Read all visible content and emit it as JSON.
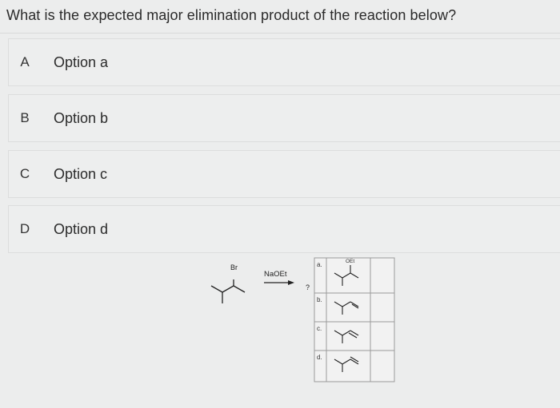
{
  "question": "What is the expected major elimination product of the reaction below?",
  "options": [
    {
      "letter": "A",
      "label": "Option a"
    },
    {
      "letter": "B",
      "label": "Option b"
    },
    {
      "letter": "C",
      "label": "Option c"
    },
    {
      "letter": "D",
      "label": "Option d"
    }
  ],
  "figure": {
    "substituent": "Br",
    "reagent": "NaOEt",
    "unknown": "?",
    "choices": [
      {
        "letter": "a.",
        "group": "OEt"
      },
      {
        "letter": "b."
      },
      {
        "letter": "c."
      },
      {
        "letter": "d."
      }
    ]
  }
}
